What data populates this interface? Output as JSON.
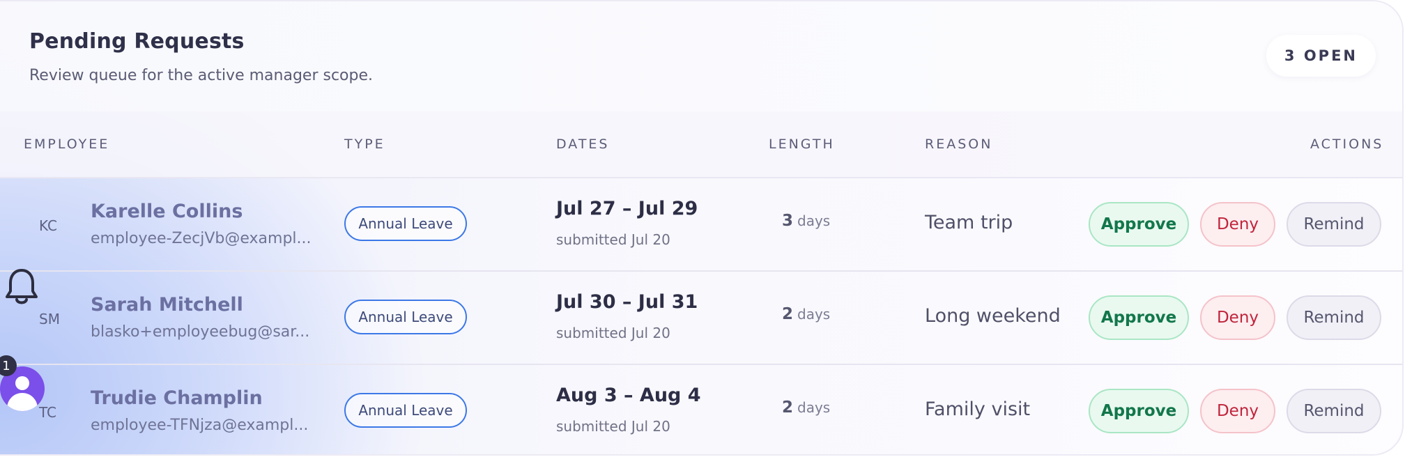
{
  "header": {
    "title": "Pending Requests",
    "subtitle": "Review queue for the active manager scope.",
    "open_badge": "3 OPEN"
  },
  "columns": {
    "employee": "EMPLOYEE",
    "type": "TYPE",
    "dates": "DATES",
    "length": "LENGTH",
    "reason": "REASON",
    "actions": "ACTIONS"
  },
  "actions": {
    "approve": "Approve",
    "deny": "Deny",
    "remind": "Remind"
  },
  "rows": [
    {
      "initials": "KC",
      "name": "Karelle Collins",
      "email": "employee-ZecjVb@exampl...",
      "type": "Annual Leave",
      "dates": "Jul 27 – Jul 29",
      "submitted": "submitted Jul 20",
      "length_num": "3",
      "length_unit": "days",
      "reason": "Team trip"
    },
    {
      "initials": "SM",
      "name": "Sarah Mitchell",
      "email": "blasko+employeebug@sar...",
      "type": "Annual Leave",
      "dates": "Jul 30 – Jul 31",
      "submitted": "submitted Jul 20",
      "length_num": "2",
      "length_unit": "days",
      "reason": "Long weekend"
    },
    {
      "initials": "TC",
      "name": "Trudie Champlin",
      "email": "employee-TFNjza@exampl...",
      "type": "Annual Leave",
      "dates": "Aug 3 – Aug 4",
      "submitted": "submitted Jul 20",
      "length_num": "2",
      "length_unit": "days",
      "reason": "Family visit"
    }
  ],
  "overlay": {
    "notification_count": "1"
  },
  "colors": {
    "accent_blue": "#3b78e7",
    "approve_green": "#12774a",
    "deny_red": "#c0243b",
    "avatar_purple": "#7b4fe9"
  }
}
